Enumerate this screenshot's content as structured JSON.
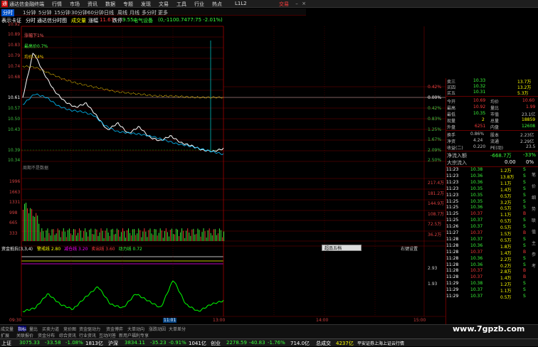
{
  "app": {
    "title": "通达信金融终端",
    "window_label": "L1L2",
    "trade_label": "交易"
  },
  "menu": [
    "行情",
    "市场",
    "资讯",
    "数据",
    "专题",
    "发现",
    "文易",
    "工具",
    "行业",
    "热点"
  ],
  "periods": [
    "分时",
    "1分钟",
    "5分钟",
    "15分钟",
    "30分钟",
    "60分钟",
    "日线",
    "周线",
    "月线",
    "多分时",
    "更多"
  ],
  "info": {
    "code": "表示卡证",
    "mode": "分时",
    "source": "通达信分时图",
    "price_label": "成交量",
    "pct_label": "涨幅",
    "price_value": "11.67",
    "chg_label": "跌停",
    "chg_value": "9.55",
    "extra_label": "电气设备",
    "extra_value": "(0,-1100.7477:75 -2.01%)"
  },
  "chart_notes": {
    "note1": "涨幅下1%",
    "note2": "最高价0.7%",
    "note3": "均价-74%",
    "no_data": "周期不是数据"
  },
  "price_axis_left": [
    "10.92",
    "10.89",
    "10.83",
    "10.79",
    "10.74",
    "10.68",
    "10.61",
    "10.57",
    "10.50",
    "10.43",
    "10.39",
    "10.34"
  ],
  "price_axis_right": [
    "0.42%",
    "0.00%",
    "0.42%",
    "0.83%",
    "1.25%",
    "1.67%",
    "2.09%",
    "2.50%"
  ],
  "volume_axis_left": [
    "1996",
    "1663",
    "1331",
    "998",
    "665",
    "333"
  ],
  "volume_axis_right": [
    "217.4万",
    "181.2万",
    "144.9万",
    "108.7万",
    "72.5万",
    "36.2万"
  ],
  "indicator": {
    "name": "资金抵抗(3,3,4)",
    "l1_label": "警戒线",
    "l1_value": "2.80",
    "l2_label": "减仓线",
    "l2_value": "3.20",
    "l3_label": "卖出线",
    "l3_value": "3.60",
    "l4_label": "动力线",
    "l4_value": "0.72",
    "axis": [
      "2.93",
      "1.93"
    ],
    "settings": "右键设置"
  },
  "time_axis": [
    "09:30",
    "11:01",
    "13:00",
    "14:00",
    "15:00"
  ],
  "buttons": {
    "mini": "超品五档"
  },
  "quote": {
    "ask3_label": "卖三",
    "ask3_price": "10.33",
    "ask3_vol": "13.7万",
    "ask4_label": "买四",
    "ask4_price": "10.32",
    "ask4_vol": "13.2万",
    "ask5_label": "买五",
    "ask5_price": "10.31",
    "ask5_vol": "5.3万",
    "open_label": "今开",
    "open": "10.69",
    "avg_label": "均价",
    "avg": "10.60",
    "high_label": "最高",
    "high": "10.92",
    "vr_label": "量比",
    "vr": "1.99",
    "low_label": "最低",
    "low": "10.35",
    "mv_label": "市值",
    "mv": "23.1亿",
    "cur_label": "现量",
    "cur": "2",
    "total_label": "总量",
    "total": "18859",
    "outer_label": "外盘",
    "outer": "6251",
    "inner_label": "内盘",
    "inner": "12608",
    "turn_label": "换手",
    "turn": "0.86%",
    "cap_label": "股本",
    "cap": "2.23亿",
    "nav_label": "净资",
    "nav": "4.24",
    "float_label": "流通",
    "float": "2.29亿",
    "eps_label": "收益(二)",
    "eps": "0.220",
    "pe_label": "PE(动)",
    "pe": "23.5",
    "flow_label": "净流入额",
    "flow": "-668.7万",
    "flow_pct": "-33%",
    "big_label": "大宗流入",
    "big": "0.00",
    "big_pct": "0%"
  },
  "ticks": [
    [
      "11:23",
      "10.38",
      "1.2万",
      "S"
    ],
    [
      "11:23",
      "10.36",
      "13.8万",
      "S"
    ],
    [
      "11:23",
      "10.36",
      "1.1万",
      "S"
    ],
    [
      "11:23",
      "10.35",
      "1.4万",
      "S"
    ],
    [
      "11:23",
      "10.35",
      "0.5万",
      "S"
    ],
    [
      "11:25",
      "10.35",
      "3.2万",
      "S"
    ],
    [
      "11:25",
      "10.36",
      "0.5万",
      "S"
    ],
    [
      "11:25",
      "10.37",
      "1.1万",
      "B"
    ],
    [
      "11:25",
      "10.37",
      "0.5万",
      "S"
    ],
    [
      "11:26",
      "10.37",
      "0.5万",
      "S"
    ],
    [
      "11:27",
      "10.37",
      "1.5万",
      "B"
    ],
    [
      "11:28",
      "10.37",
      "0.5万",
      "S"
    ],
    [
      "11:28",
      "10.36",
      "1.8万",
      "S"
    ],
    [
      "11:28",
      "10.37",
      "1.4万",
      "B"
    ],
    [
      "11:28",
      "10.36",
      "2.2万",
      "S"
    ],
    [
      "11:28",
      "10.36",
      "0.2万",
      "S"
    ],
    [
      "11:28",
      "10.37",
      "2.8万",
      "B"
    ],
    [
      "11:28",
      "10.37",
      "1.4万",
      "B"
    ],
    [
      "11:29",
      "10.38",
      "1.2万",
      "S"
    ],
    [
      "11:29",
      "10.37",
      "1.1万",
      "S"
    ],
    [
      "11:29",
      "10.37",
      "0.5万",
      "S"
    ]
  ],
  "side_tabs": [
    "笔",
    "价",
    "细",
    "势",
    "联",
    "值",
    "主",
    "参",
    "考"
  ],
  "bottom_tabs": [
    "成交量",
    "指标",
    "量比",
    "买卖力道",
    "竞价图",
    "资金驱动力",
    "资金博弈",
    "大单动向",
    "涨跌动因",
    "大单差分"
  ],
  "bottom_tabs2": [
    "扩展",
    "关联报价",
    "资金分布",
    "综合资讯",
    "行业资讯",
    "互动问答",
    "新用户福利专享"
  ],
  "status": {
    "sh_label": "上证",
    "sh": "3075.33",
    "sh_chg": "-33.58",
    "sh_pct": "-1.08%",
    "sh_amt": "1813亿",
    "sz_label": "沪深",
    "sz": "3834.11",
    "sz_chg": "-35.23",
    "sz_pct": "-0.91%",
    "sz_amt": "1041亿",
    "cy_label": "创业",
    "cy": "2278.59",
    "cy_chg": "-40.83",
    "cy_pct": "-1.76%",
    "cy_amt": "714.0亿",
    "total_label": "总成交",
    "total": "4237亿",
    "broker": "平安证券上海上证云行情"
  },
  "watermark": "www.7gpzb.com",
  "colors": {
    "up": "#ff3c3c",
    "down": "#3cff3c",
    "price_line": "#ffffff",
    "avg_line": "#ffd000",
    "grid": "#8b0000"
  }
}
